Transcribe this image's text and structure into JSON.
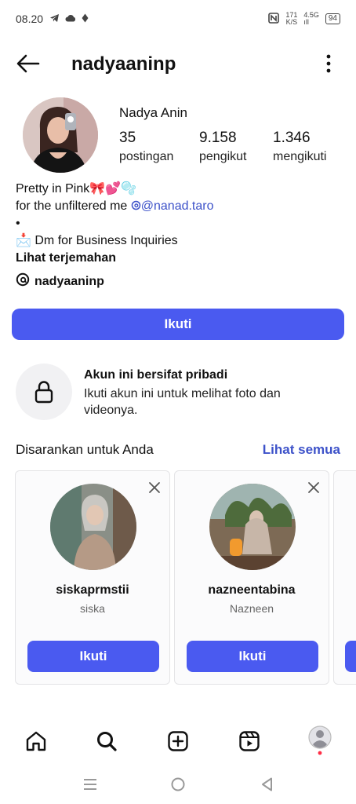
{
  "status_bar": {
    "time": "08.20",
    "net_speed_top": "171",
    "net_speed_bottom": "K/S",
    "network_top": "4.5G",
    "network_bottom": "ıll",
    "battery": "94"
  },
  "header": {
    "username": "nadyaaninp"
  },
  "profile": {
    "display_name": "Nadya Anin",
    "stats": [
      {
        "value": "35",
        "label": "postingan"
      },
      {
        "value": "9.158",
        "label": "pengikut"
      },
      {
        "value": "1.346",
        "label": "mengikuti"
      }
    ],
    "bio_line1": "Pretty in Pink🎀💕🫧",
    "bio_line2_prefix": "for the unfiltered me ",
    "bio_link": "@nanad.taro",
    "bio_bullet": "•",
    "bio_line4": "📩 Dm for Business Inquiries",
    "translate": "Lihat terjemahan",
    "threads_handle": "nadyaaninp"
  },
  "follow_button": "Ikuti",
  "private": {
    "title": "Akun ini bersifat pribadi",
    "description": "Ikuti akun ini untuk melihat foto dan videonya."
  },
  "suggestions": {
    "title": "Disarankan untuk Anda",
    "see_all": "Lihat semua",
    "cards": [
      {
        "username": "siskaprmstii",
        "name": "siska",
        "button": "Ikuti"
      },
      {
        "username": "nazneentabina",
        "name": "Nazneen",
        "button": "Ikuti"
      }
    ]
  },
  "bottom_nav": [
    "home-icon",
    "search-icon",
    "create-icon",
    "reels-icon",
    "profile-avatar"
  ],
  "colors": {
    "accent": "#4a5af0",
    "link": "#3d52c9"
  }
}
